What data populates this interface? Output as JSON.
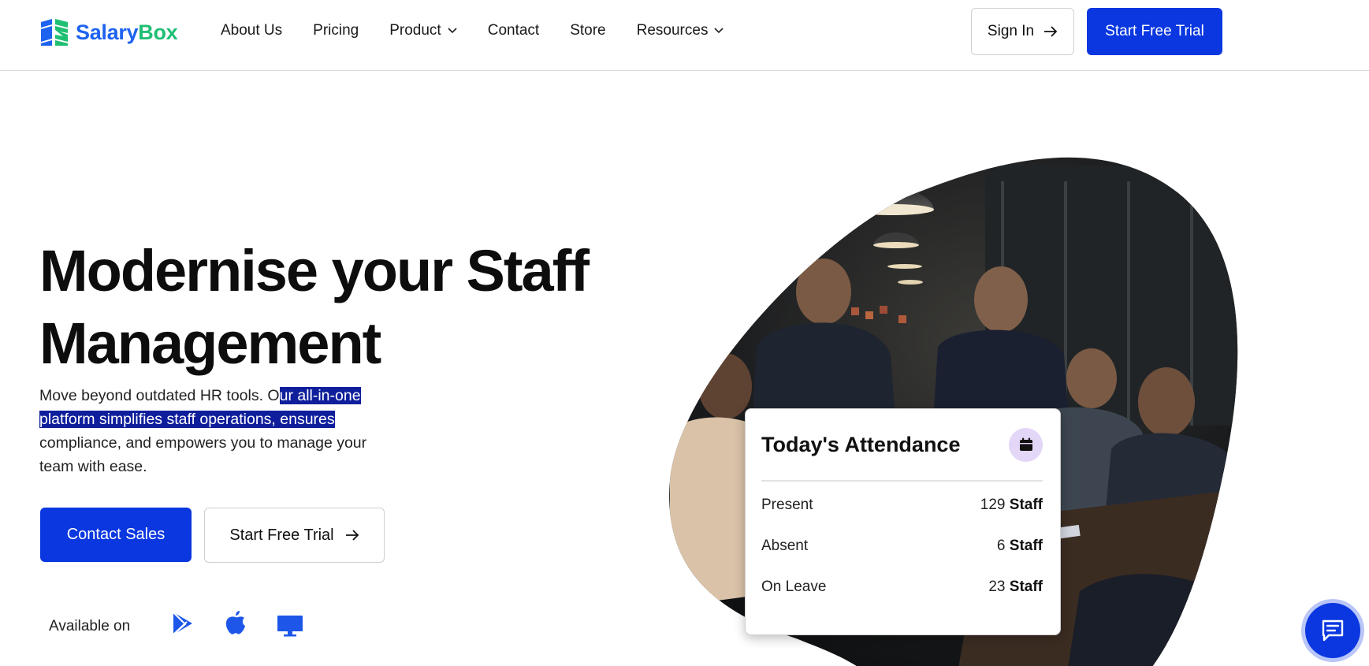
{
  "brand": {
    "name_part1": "Salary",
    "name_part2": "Box",
    "color_primary": "#1d63f0",
    "color_secondary": "#1fbf73"
  },
  "nav": {
    "items": [
      {
        "label": "About Us",
        "dropdown": false
      },
      {
        "label": "Pricing",
        "dropdown": false
      },
      {
        "label": "Product",
        "dropdown": true
      },
      {
        "label": "Contact",
        "dropdown": false
      },
      {
        "label": "Store",
        "dropdown": false
      },
      {
        "label": "Resources",
        "dropdown": true
      }
    ],
    "sign_in": "Sign In",
    "start_trial": "Start Free Trial"
  },
  "hero": {
    "headline_line1": "Modernise your Staff",
    "headline_line2": "Management",
    "sub_before": "Move beyond outdated HR tools. O",
    "sub_highlight": "ur all-in-one platform simplifies staff operations, ensures",
    "sub_after": " compliance, and empowers you to manage your team with ease.",
    "contact_sales": "Contact Sales",
    "start_trial": "Start Free Trial",
    "available_on": "Available on",
    "platform_icons": [
      "google-play-icon",
      "apple-icon",
      "desktop-icon"
    ]
  },
  "attendance": {
    "title": "Today's Attendance",
    "rows": [
      {
        "label": "Present",
        "count": "129",
        "unit": "Staff"
      },
      {
        "label": "Absent",
        "count": "6",
        "unit": "Staff"
      },
      {
        "label": "On Leave",
        "count": "23",
        "unit": "Staff"
      }
    ]
  },
  "colors": {
    "accent": "#0a37e0",
    "highlight": "#0f1f9c",
    "calendar_bg": "#e3d6f7"
  }
}
